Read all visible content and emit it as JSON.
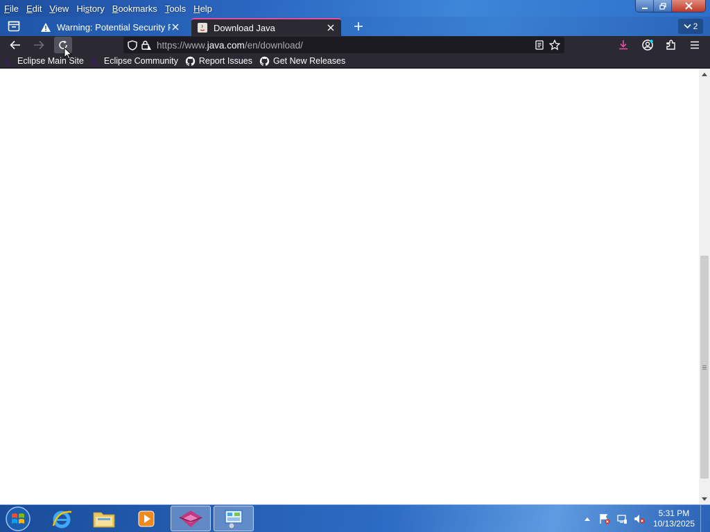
{
  "menubar": {
    "items": [
      {
        "label_acc": "F",
        "label_rest": "ile"
      },
      {
        "label_acc": "E",
        "label_rest": "dit"
      },
      {
        "label_acc": "V",
        "label_rest": "iew"
      },
      {
        "label_pre": "Hi",
        "label_acc": "s",
        "label_rest": "tory"
      },
      {
        "label_acc": "B",
        "label_rest": "ookmarks"
      },
      {
        "label_acc": "T",
        "label_rest": "ools"
      },
      {
        "label_acc": "H",
        "label_rest": "elp"
      }
    ]
  },
  "tabs": [
    {
      "title": "Warning: Potential Security Risk Ahead",
      "icon": "warning-icon"
    },
    {
      "title": "Download Java",
      "icon": "java-page-icon",
      "active": true
    }
  ],
  "tab_count": "2",
  "url": {
    "prefix": "https://www.",
    "domain": "java.com",
    "path": "/en/download/"
  },
  "bookmarks": [
    {
      "label": "Eclipse Main Site",
      "icon": "eclipse-icon"
    },
    {
      "label": "Eclipse Community",
      "icon": "eclipse-icon"
    },
    {
      "label": "Report Issues",
      "icon": "github-icon"
    },
    {
      "label": "Get New Releases",
      "icon": "github-icon"
    }
  ],
  "clock": {
    "time": "5:31 PM",
    "date": "10/13/2025"
  },
  "colors": {
    "accent_tab": "#e34ea5",
    "toolbar": "#2b2a33",
    "urlbar": "#1c1b22"
  }
}
